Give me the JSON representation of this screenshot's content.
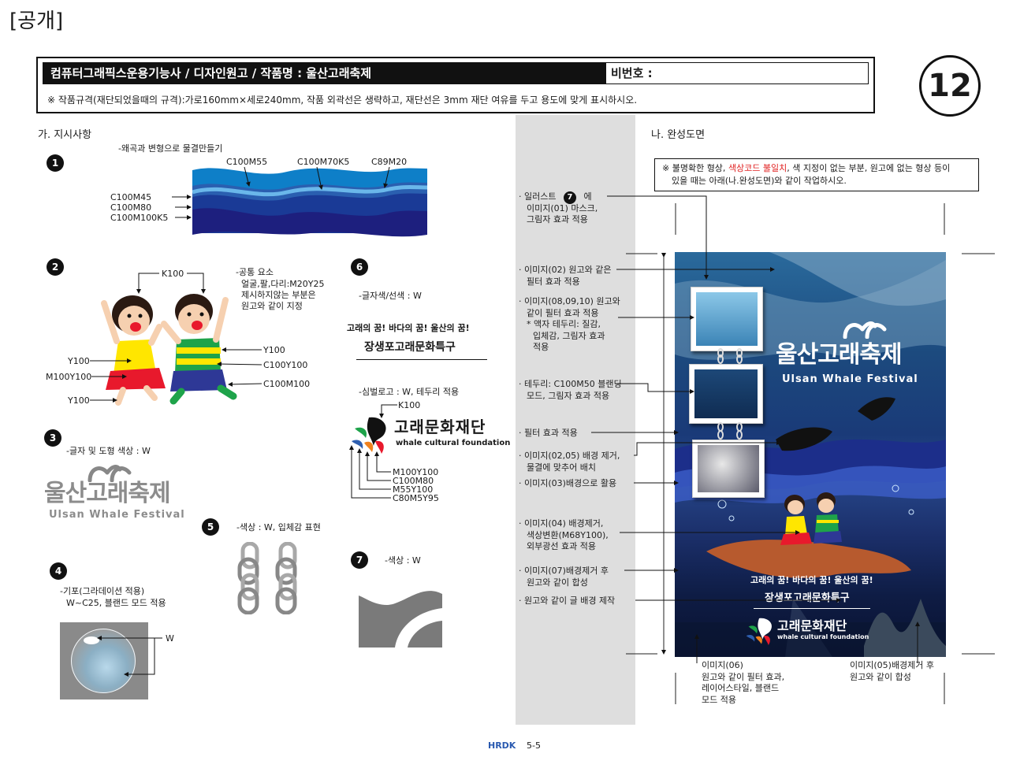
{
  "header": {
    "tag": "[공개]",
    "title": "컴퓨터그래픽스운용기능사 / 디자인원고 / 작품명 : 울산고래축제",
    "id_label": "비번호 :",
    "spec": "※ 작품규격(재단되었을때의 규격):가로160mm×세로240mm, 작품 외곽선은 생략하고, 재단선은 3mm 재단 여유를 두고 용도에 맞게 표시하시오.",
    "number": "12"
  },
  "left": {
    "heading": "가. 지시사항",
    "s1": {
      "num": "1",
      "desc": "-왜곡과 변형으로 물결만들기",
      "labels_top": [
        "C100M55",
        "C100M70K5",
        "C89M20"
      ],
      "labels_left": [
        "C100M45",
        "C100M80",
        "C100M100K5"
      ]
    },
    "s2": {
      "num": "2",
      "k": "K100",
      "common": [
        "-공통 요소",
        "얼굴,팔,다리:M20Y25",
        "제시하지않는 부분은",
        "원고와 같이 지정"
      ],
      "left_labels": [
        "Y100",
        "M100Y100",
        "Y100"
      ],
      "right_labels": [
        "Y100",
        "C100Y100",
        "C100M100"
      ]
    },
    "s3": {
      "num": "3",
      "desc": "-글자 및 도형 색상 : W",
      "logo_kr": "울산고래축제",
      "logo_en": "Ulsan Whale Festival"
    },
    "s4": {
      "num": "4",
      "desc": [
        "-기포(그라데이션 적용)",
        "W~C25, 블랜드 모드 적용"
      ],
      "w": "W"
    },
    "s5": {
      "num": "5",
      "desc": "-색상 : W, 입체감 표현"
    },
    "s6": {
      "num": "6",
      "desc": "-글자색/선색 : W",
      "line1": "고래의 꿈! 바다의 꿈! 울산의 꿈!",
      "line2": "장생포고래문화특구",
      "logo_desc": "-심벌로고 : W, 테두리 적용",
      "k": "K100",
      "foundation_kr": "고래문화재단",
      "foundation_en": "whale cultural foundation",
      "colors": [
        "M100Y100",
        "C100M80",
        "M55Y100",
        "C80M5Y95"
      ]
    },
    "s7": {
      "num": "7",
      "desc": "-색상 : W"
    }
  },
  "right": {
    "heading": "나. 완성도면",
    "notice_pre": "※ 불명확한 형상, ",
    "notice_red": "색상코드 불일치",
    "notice_post": ", 색 지정이 없는 부분, 원고에 없는 형상 등이",
    "notice_line2": "있을 때는 아래(나.완성도면)와 같이 작업하시오.",
    "notes": [
      [
        "· 일러스트",
        "에",
        "이미지(01) 마스크,",
        "그림자 효과 적용"
      ],
      [
        "· 이미지(02) 원고와 같은",
        "필터 효과 적용"
      ],
      [
        "· 이미지(08,09,10) 원고와",
        "같이 필터 효과 적용",
        "* 액자 테두리: 질감,",
        "입체감, 그림자 효과",
        "적용"
      ],
      [
        "· 테두리: C100M50 블랜딩",
        "모드, 그림자 효과 적용"
      ],
      [
        "· 필터 효과 적용"
      ],
      [
        "· 이미지(02,05) 배경 제거,",
        "물결에 맞추어 배치"
      ],
      [
        "· 이미지(03)배경으로 활용"
      ],
      [
        "· 이미지(04) 배경제거,",
        "색상변환(M68Y100),",
        "외부광선 효과 적용"
      ],
      [
        "· 이미지(07)배경제거 후",
        "원고와 같이 합성"
      ],
      [
        "· 원고와 같이 글 배경 제작"
      ]
    ],
    "illust_num": "7",
    "bottom_left": [
      "이미지(06)",
      "원고와 같이 필터 효과,",
      "레이어스타일, 블랜드",
      "모드 적용"
    ],
    "bottom_right": [
      "이미지(05)배경제거 후",
      "원고와 같이 합성"
    ],
    "poster": {
      "title_kr": "울산고래축제",
      "title_en": "Ulsan Whale Festival",
      "slogan": "고래의 꿈! 바다의 꿈! 울산의 꿈!",
      "district": "장생포고래문화특구",
      "foundation_kr": "고래문화재단",
      "foundation_en": "whale cultural foundation"
    }
  },
  "footer": {
    "brand": "HRDK",
    "page": "5-5"
  }
}
